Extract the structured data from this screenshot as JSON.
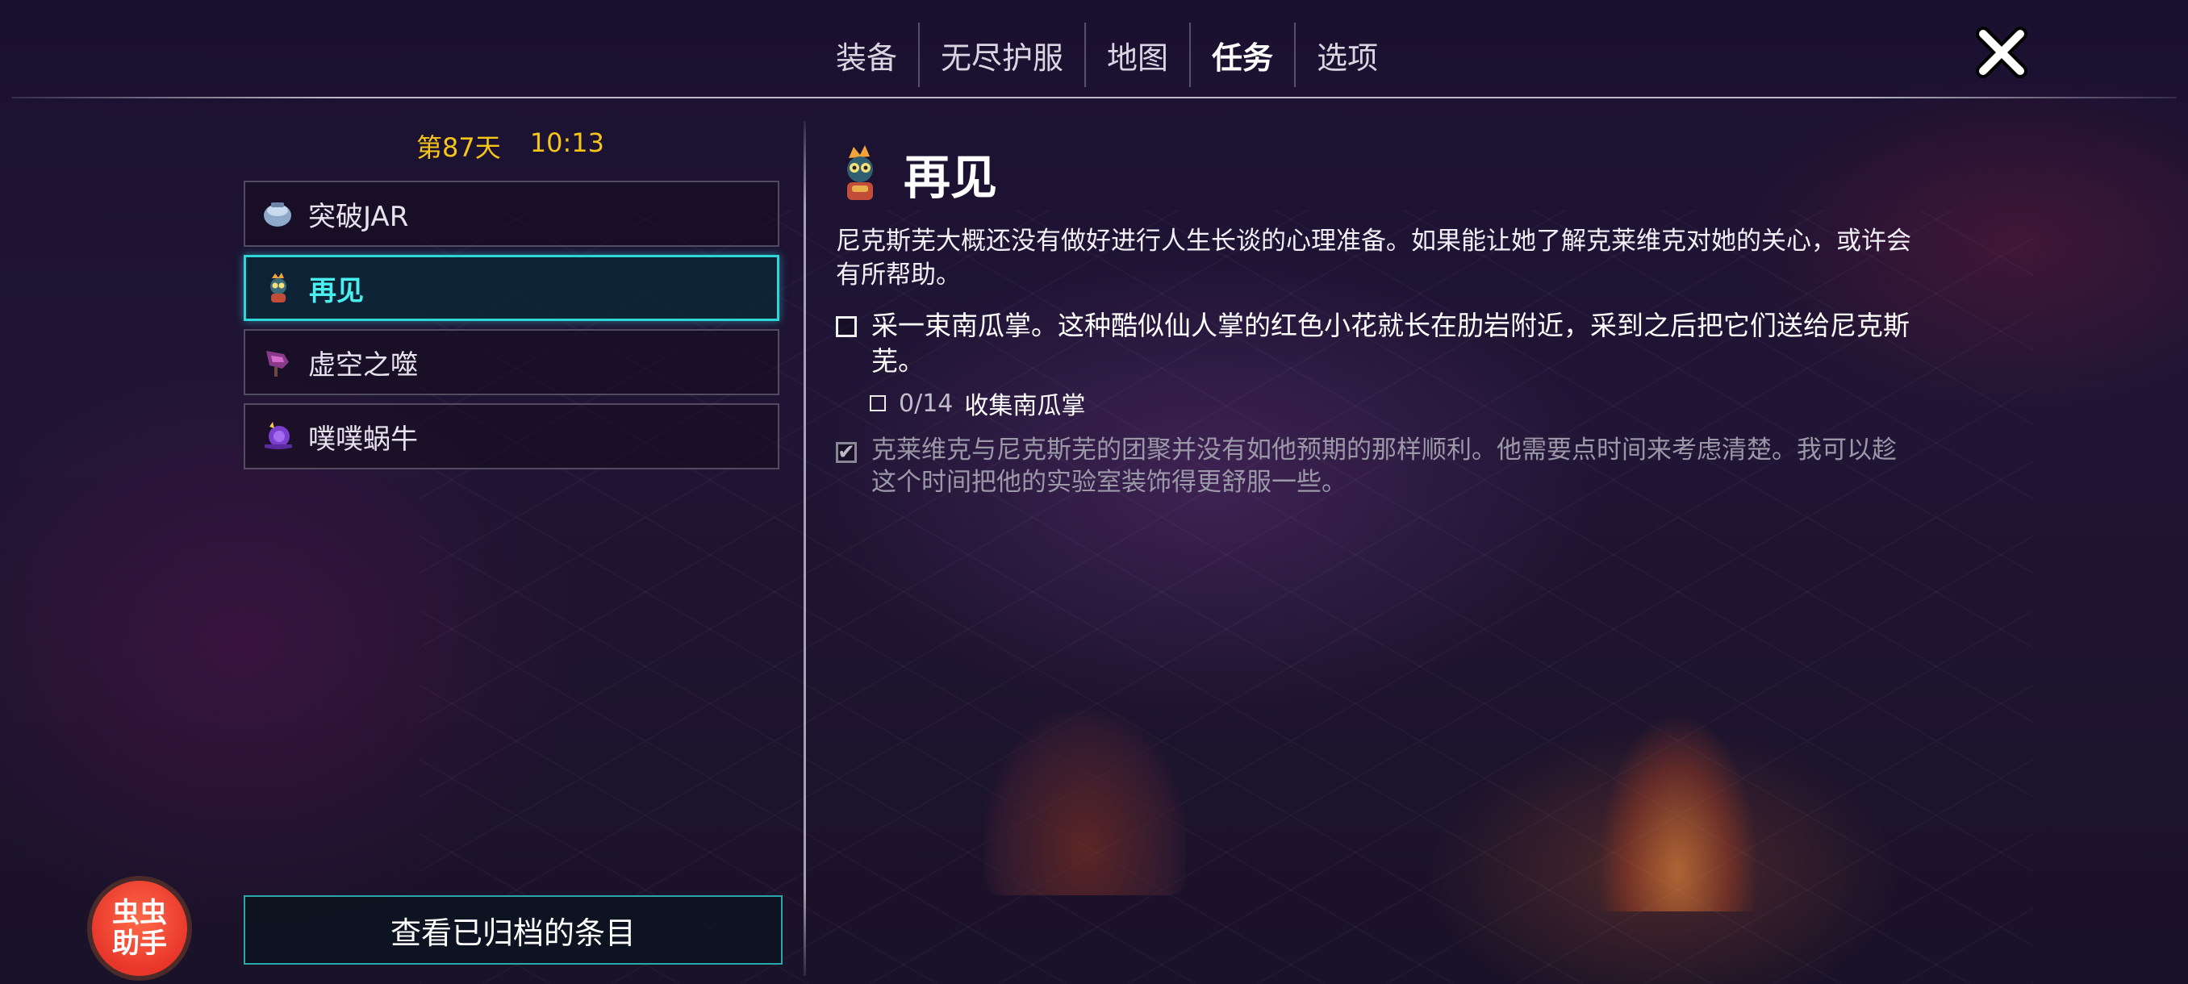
{
  "nav": {
    "tabs": [
      {
        "label": "装备",
        "active": false
      },
      {
        "label": "无尽护服",
        "active": false
      },
      {
        "label": "地图",
        "active": false
      },
      {
        "label": "任务",
        "active": true
      },
      {
        "label": "选项",
        "active": false
      }
    ],
    "close_icon": "close-x-icon"
  },
  "status": {
    "day": "第87天",
    "time": "10:13"
  },
  "quests": [
    {
      "label": "突破JAR",
      "icon": "jar-icon",
      "selected": false
    },
    {
      "label": "再见",
      "icon": "character-portrait-icon",
      "selected": true
    },
    {
      "label": "虚空之噬",
      "icon": "void-bite-icon",
      "selected": false
    },
    {
      "label": "噗噗蜗牛",
      "icon": "snail-icon",
      "selected": false
    }
  ],
  "archive_button": "查看已归档的条目",
  "helper_badge": "虫虫\n助手",
  "detail": {
    "title": "再见",
    "description": "尼克斯芜大概还没有做好进行人生长谈的心理准备。如果能让她了解克莱维克对她的关心，或许会有所帮助。",
    "objectives": [
      {
        "text": "采一束南瓜掌。这种酷似仙人掌的红色小花就长在肋岩附近，采到之后把它们送给尼克斯芜。",
        "completed": false,
        "subtasks": [
          {
            "count": "0/14",
            "label": "收集南瓜掌",
            "completed": false
          }
        ]
      },
      {
        "text": "克莱维克与尼克斯芜的团聚并没有如他预期的那样顺利。他需要点时间来考虑清楚。我可以趁这个时间把他的实验室装饰得更舒服一些。",
        "completed": true
      }
    ]
  },
  "colors": {
    "accent_cyan": "#2fd6d8",
    "day_yellow": "#f5c518",
    "badge_red": "#e8362a"
  }
}
